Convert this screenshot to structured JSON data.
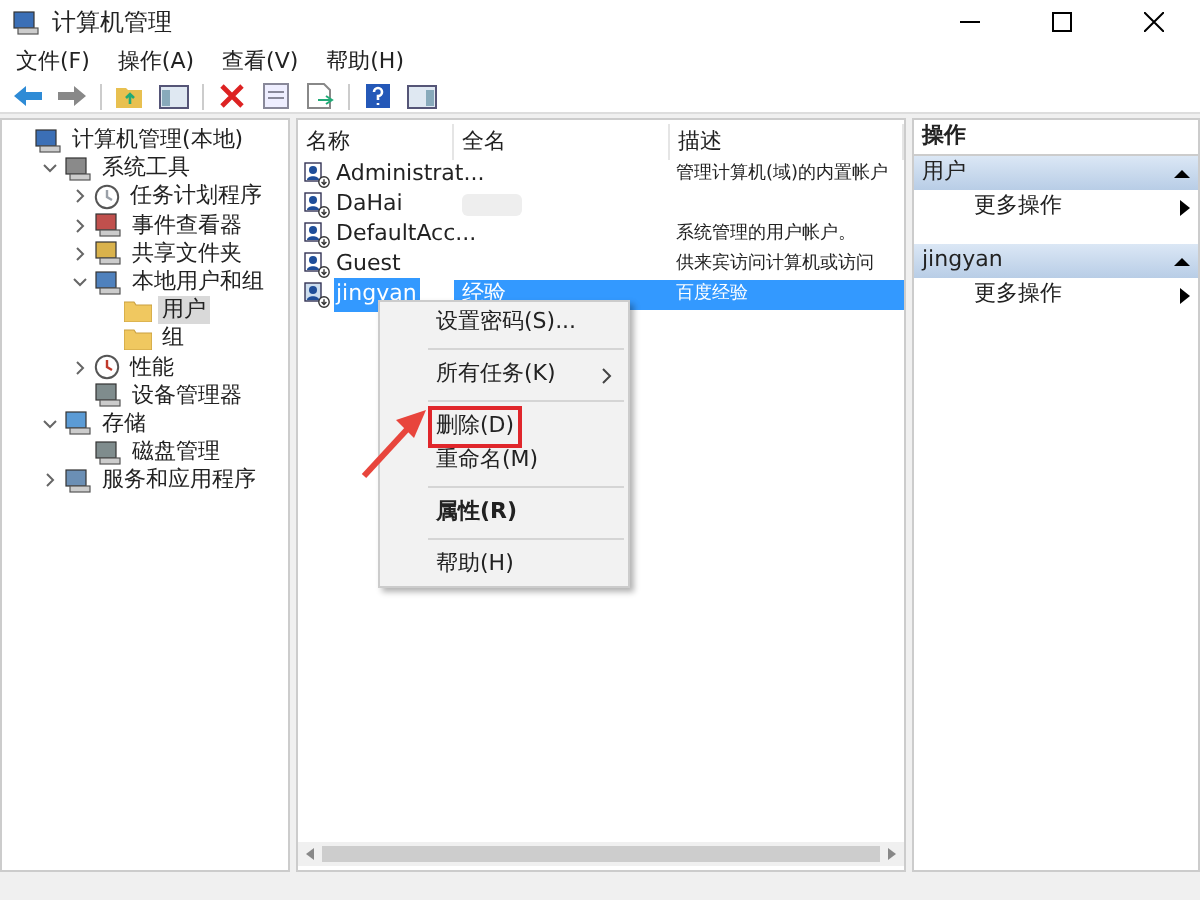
{
  "window": {
    "title": "计算机管理"
  },
  "menu": [
    "文件(F)",
    "操作(A)",
    "查看(V)",
    "帮助(H)"
  ],
  "tree": [
    {
      "label": "计算机管理(本地)",
      "selected": false,
      "children": [
        {
          "label": "系统工具",
          "selected": false,
          "expanded": true,
          "children": [
            {
              "label": "任务计划程序",
              "selected": false,
              "expanded": false
            },
            {
              "label": "事件查看器",
              "selected": false,
              "expanded": false
            },
            {
              "label": "共享文件夹",
              "selected": false,
              "expanded": false
            },
            {
              "label": "本地用户和组",
              "selected": false,
              "expanded": true,
              "children": [
                {
                  "label": "用户",
                  "selected": true
                },
                {
                  "label": "组",
                  "selected": false
                }
              ]
            },
            {
              "label": "性能",
              "selected": false,
              "expanded": false
            },
            {
              "label": "设备管理器",
              "selected": false
            }
          ]
        },
        {
          "label": "存储",
          "selected": false,
          "expanded": true,
          "children": [
            {
              "label": "磁盘管理",
              "selected": false
            }
          ]
        },
        {
          "label": "服务和应用程序",
          "selected": false,
          "expanded": false
        }
      ]
    }
  ],
  "table": {
    "columns": [
      "名称",
      "全名",
      "描述"
    ],
    "rows": [
      {
        "name": "Administrat...",
        "description": "管理计算机(域)的内置帐户",
        "selected": false,
        "blurred": false
      },
      {
        "name": "DaHai",
        "selected": false,
        "blurred": true
      },
      {
        "name": "DefaultAcc...",
        "description": "系统管理的用户帐户。",
        "selected": false,
        "blurred": false
      },
      {
        "name": "Guest",
        "description": "供来宾访问计算机或访问",
        "selected": false,
        "blurred": false
      },
      {
        "name": "jingyan",
        "full_name": "经验",
        "description": "百度经验",
        "selected": true,
        "blurred": false
      }
    ]
  },
  "context_menu": [
    {
      "kind": "item",
      "label": "设置密码(S)...",
      "bold": false,
      "submenu": false,
      "highlighted": false
    },
    {
      "kind": "separator"
    },
    {
      "kind": "item",
      "label": "所有任务(K)",
      "bold": false,
      "submenu": true,
      "highlighted": false
    },
    {
      "kind": "separator"
    },
    {
      "kind": "item",
      "label": "删除(D)",
      "bold": false,
      "submenu": false,
      "highlighted": true
    },
    {
      "kind": "item",
      "label": "重命名(M)",
      "bold": false,
      "submenu": false,
      "highlighted": false
    },
    {
      "kind": "separator"
    },
    {
      "kind": "item",
      "label": "属性(R)",
      "bold": true,
      "submenu": false,
      "highlighted": false
    },
    {
      "kind": "separator"
    },
    {
      "kind": "item",
      "label": "帮助(H)",
      "bold": false,
      "submenu": false,
      "highlighted": false
    }
  ],
  "actions": {
    "title": "操作",
    "sections": [
      {
        "title": "用户",
        "expanded": true,
        "items": [
          "更多操作"
        ]
      },
      {
        "title": "jingyan",
        "expanded": true,
        "items": [
          "更多操作"
        ]
      }
    ]
  }
}
